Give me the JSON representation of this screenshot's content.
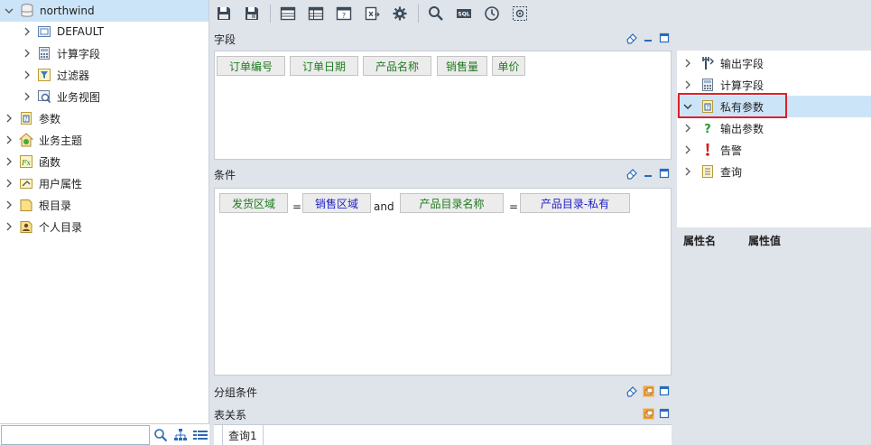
{
  "left_tree": {
    "root": {
      "label": "northwind"
    },
    "children": [
      {
        "label": "DEFAULT",
        "icon": "default-folder-icon"
      },
      {
        "label": "计算字段",
        "icon": "calc-field-icon"
      },
      {
        "label": "过滤器",
        "icon": "filter-icon"
      },
      {
        "label": "业务视图",
        "icon": "business-view-icon"
      }
    ],
    "top_items": [
      {
        "label": "参数",
        "icon": "param-icon"
      },
      {
        "label": "业务主题",
        "icon": "business-topic-icon"
      },
      {
        "label": "函数",
        "icon": "function-icon"
      },
      {
        "label": "用户属性",
        "icon": "user-attr-icon"
      },
      {
        "label": "根目录",
        "icon": "root-folder-icon"
      },
      {
        "label": "个人目录",
        "icon": "personal-folder-icon"
      }
    ],
    "search": {
      "value": "",
      "placeholder": ""
    }
  },
  "sections": {
    "fields": {
      "title": "字段",
      "chips": [
        "订单编号",
        "订单日期",
        "产品名称",
        "销售量",
        "单价"
      ]
    },
    "conditions": {
      "title": "条件",
      "expr": {
        "left1": "发货区域",
        "op1": "=",
        "right1": "销售区域",
        "connector": "and",
        "left2": "产品目录名称",
        "op2": "=",
        "right2": "产品目录-私有"
      }
    },
    "group": {
      "title": "分组条件"
    },
    "relations": {
      "title": "表关系"
    }
  },
  "right_tree": {
    "items": [
      {
        "label": "输出字段",
        "icon": "output-field-icon"
      },
      {
        "label": "计算字段",
        "icon": "calc-field-icon"
      },
      {
        "label": "私有参数",
        "icon": "private-param-icon"
      },
      {
        "label": "输出参数",
        "icon": "output-param-icon"
      },
      {
        "label": "告警",
        "icon": "alert-icon"
      },
      {
        "label": "查询",
        "icon": "query-icon"
      }
    ],
    "selected_index": 2
  },
  "properties": {
    "name_header": "属性名",
    "value_header": "属性值"
  },
  "bottom_tabs": {
    "active": "查询1"
  },
  "colors": {
    "selection": "#cce4f7",
    "highlight_box": "#e0202a",
    "field_text": "#1f7a1f",
    "param_text": "#2020c8"
  }
}
